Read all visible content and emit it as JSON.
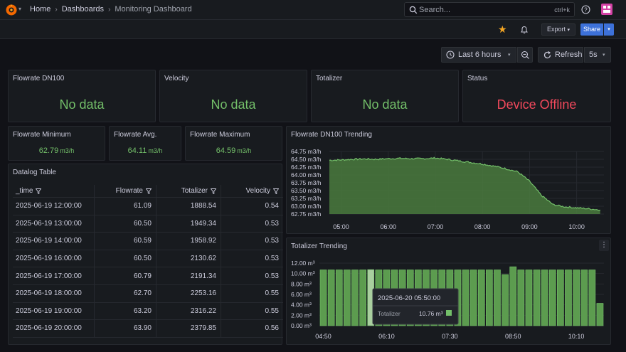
{
  "breadcrumb": {
    "home": "Home",
    "dashboards": "Dashboards",
    "current": "Monitoring Dashboard"
  },
  "search": {
    "placeholder": "Search...",
    "shortcut": "ctrl+k"
  },
  "toolbar": {
    "export_label": "Export",
    "share_label": "Share"
  },
  "time": {
    "range_label": "Last 6 hours",
    "refresh_label": "Refresh",
    "interval": "5s"
  },
  "panels": {
    "flowrate_dn100": {
      "title": "Flowrate DN100",
      "value": "No data"
    },
    "velocity": {
      "title": "Velocity",
      "value": "No data"
    },
    "totalizer": {
      "title": "Totalizer",
      "value": "No data"
    },
    "status": {
      "title": "Status",
      "value": "Device Offline"
    },
    "flow_min": {
      "title": "Flowrate Minimum",
      "value": "62.79",
      "unit": "m3/h"
    },
    "flow_avg": {
      "title": "Flowrate Avg.",
      "value": "64.11",
      "unit": "m3/h"
    },
    "flow_max": {
      "title": "Flowrate Maximum",
      "value": "64.59",
      "unit": "m3/h"
    },
    "datalog": {
      "title": "Datalog Table"
    },
    "trend": {
      "title": "Flowrate DN100 Trending"
    },
    "totalizer_trend": {
      "title": "Totalizer Trending"
    }
  },
  "table": {
    "columns": [
      "_time",
      "Flowrate",
      "Totalizer",
      "Velocity"
    ],
    "rows": [
      [
        "2025-06-19 12:00:00",
        "61.09",
        "1888.54",
        "0.54"
      ],
      [
        "2025-06-19 13:00:00",
        "60.50",
        "1949.34",
        "0.53"
      ],
      [
        "2025-06-19 14:00:00",
        "60.59",
        "1958.92",
        "0.53"
      ],
      [
        "2025-06-19 16:00:00",
        "60.50",
        "2130.62",
        "0.53"
      ],
      [
        "2025-06-19 17:00:00",
        "60.79",
        "2191.34",
        "0.53"
      ],
      [
        "2025-06-19 18:00:00",
        "62.70",
        "2253.16",
        "0.55"
      ],
      [
        "2025-06-19 19:00:00",
        "63.20",
        "2316.22",
        "0.55"
      ],
      [
        "2025-06-19 20:00:00",
        "63.90",
        "2379.85",
        "0.56"
      ]
    ]
  },
  "tooltip": {
    "time": "2025-06-20 05:50:00",
    "series": "Totalizer",
    "value": "10.76 m³"
  },
  "colors": {
    "green": "#73bf69",
    "red": "#f2495c",
    "accent": "#3d71d9",
    "star": "#f5a623"
  },
  "chart_data": [
    {
      "type": "area",
      "title": "Flowrate DN100 Trending",
      "y_ticks": [
        "64.75 m3/h",
        "64.50 m3/h",
        "64.25 m3/h",
        "64.00 m3/h",
        "63.75 m3/h",
        "63.50 m3/h",
        "63.25 m3/h",
        "63.00 m3/h",
        "62.75 m3/h"
      ],
      "x_ticks": [
        "05:00",
        "06:00",
        "07:00",
        "08:00",
        "09:00",
        "10:00"
      ],
      "ylim": [
        62.75,
        64.75
      ],
      "x_hours": [
        4.75,
        5.0,
        5.25,
        5.5,
        5.75,
        6.0,
        6.25,
        6.5,
        6.75,
        7.0,
        7.25,
        7.5,
        7.75,
        8.0,
        8.25,
        8.5,
        8.75,
        9.0,
        9.25,
        9.5,
        9.75,
        10.0,
        10.25,
        10.5
      ],
      "values": [
        64.47,
        64.48,
        64.5,
        64.51,
        64.5,
        64.52,
        64.53,
        64.52,
        64.52,
        64.54,
        64.5,
        64.45,
        64.4,
        64.35,
        64.28,
        64.2,
        64.1,
        63.8,
        63.35,
        63.05,
        62.98,
        62.95,
        62.92,
        62.88
      ]
    },
    {
      "type": "bar",
      "title": "Totalizer Trending",
      "y_ticks": [
        "12.00 m³",
        "10.00 m³",
        "8.00 m³",
        "6.00 m³",
        "4.00 m³",
        "2.00 m³",
        "0.00 m³"
      ],
      "x_ticks": [
        "04:50",
        "06:10",
        "07:30",
        "08:50",
        "10:10"
      ],
      "ylim": [
        0,
        12
      ],
      "values": [
        10.7,
        10.7,
        10.7,
        10.7,
        10.7,
        10.7,
        10.76,
        10.7,
        10.7,
        10.7,
        10.7,
        10.7,
        10.7,
        10.7,
        10.7,
        10.7,
        10.7,
        10.7,
        10.7,
        10.7,
        10.7,
        10.7,
        10.7,
        9.8,
        11.3,
        10.7,
        10.7,
        10.7,
        10.7,
        10.7,
        10.7,
        10.7,
        10.7,
        10.7,
        10.7,
        4.3
      ]
    }
  ]
}
